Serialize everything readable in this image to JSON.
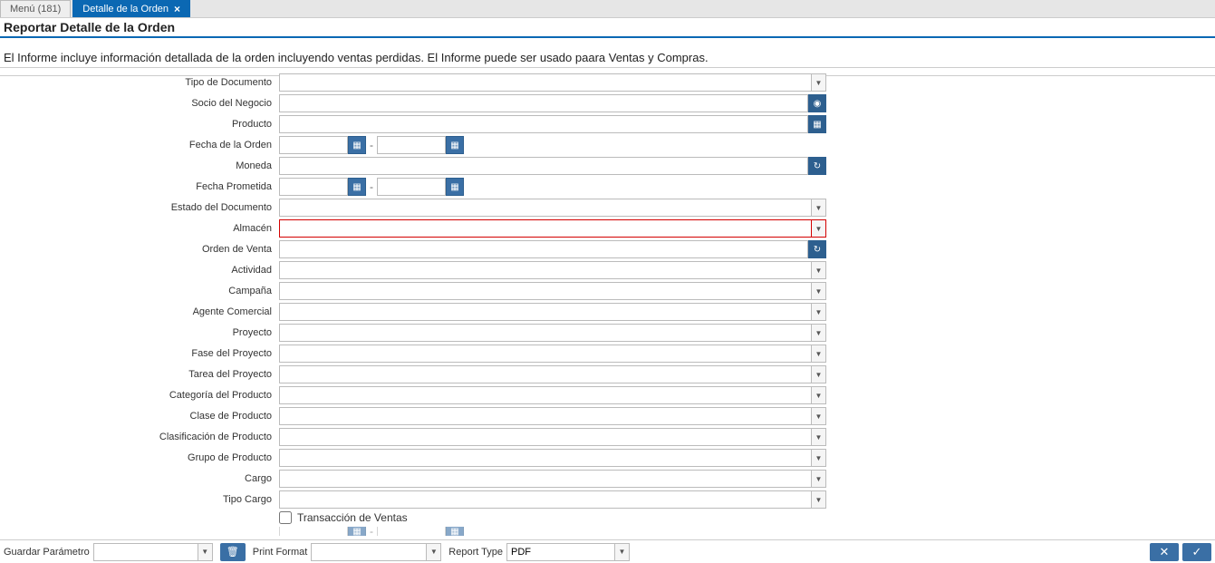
{
  "tabs": [
    {
      "label": "Menú (181)"
    },
    {
      "label": "Detalle de la Orden"
    }
  ],
  "title": "Reportar Detalle de la Orden",
  "subtitle": "El Informe incluye información detallada de la orden incluyendo ventas perdidas. El Informe puede ser usado paara Ventas y Compras.",
  "fields": {
    "tipoDocumento": "Tipo de Documento",
    "socioNegocio": "Socio del Negocio",
    "producto": "Producto",
    "fechaOrden": "Fecha de la Orden",
    "moneda": "Moneda",
    "fechaPrometida": "Fecha Prometida",
    "estadoDocumento": "Estado del Documento",
    "almacen": "Almacén",
    "ordenVenta": "Orden de Venta",
    "actividad": "Actividad",
    "campana": "Campaña",
    "agenteComercial": "Agente Comercial",
    "proyecto": "Proyecto",
    "faseProyecto": "Fase del Proyecto",
    "tareaProyecto": "Tarea del Proyecto",
    "categoriaProducto": "Categoría del Producto",
    "claseProducto": "Clase de Producto",
    "clasificacionProducto": "Clasificación de Producto",
    "grupoProducto": "Grupo de Producto",
    "cargo": "Cargo",
    "tipoCargo": "Tipo Cargo",
    "transaccionVentas": "Transacción de Ventas"
  },
  "bottom": {
    "guardarParametro": "Guardar Parámetro",
    "guardarValue": "",
    "printFormat": "Print Format",
    "printFormatValue": "",
    "reportType": "Report Type",
    "reportTypeValue": "PDF"
  },
  "icons": {
    "close": "×",
    "calendar": "▦",
    "search": "◉",
    "grid": "▦",
    "refresh": "↻",
    "dropdown": "▼",
    "trash": "🗑",
    "cancel": "✕",
    "ok": "✓"
  }
}
